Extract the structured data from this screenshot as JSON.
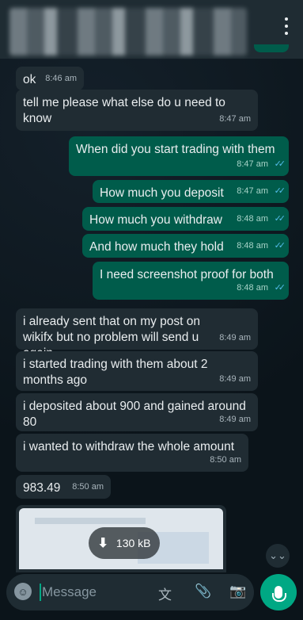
{
  "header": {
    "menu_icon": "more-vertical-icon"
  },
  "messages": [
    {
      "dir": "in",
      "text": "ok",
      "time": "8:46 am"
    },
    {
      "dir": "in",
      "text": "tell me please what else do u need to know",
      "time": "8:47 am"
    },
    {
      "dir": "out",
      "text": "When did you start trading with them",
      "time": "8:47 am"
    },
    {
      "dir": "out",
      "text": "How much you deposit",
      "time": "8:47 am"
    },
    {
      "dir": "out",
      "text": "How much you withdraw",
      "time": "8:48 am"
    },
    {
      "dir": "out",
      "text": "And how much they hold",
      "time": "8:48 am"
    },
    {
      "dir": "out",
      "text": "I need screenshot proof for both",
      "time": "8:48 am"
    },
    {
      "dir": "in",
      "text": "i already sent that on my post on wikifx but no problem will send u again",
      "time": "8:49 am"
    },
    {
      "dir": "in",
      "text": "i started trading with them about 2 months ago",
      "time": "8:49 am"
    },
    {
      "dir": "in",
      "text": "i deposited about 900 and gained around 80",
      "time": "8:49 am"
    },
    {
      "dir": "in",
      "text": "i wanted to withdraw the whole amount",
      "time": "8:50 am"
    },
    {
      "dir": "in",
      "text": "983.49",
      "time": "8:50 am"
    }
  ],
  "media": {
    "size": "130 kB"
  },
  "composer": {
    "placeholder": "Message",
    "icons": [
      "emoji-icon",
      "translate-icon",
      "attach-icon",
      "camera-icon",
      "mic-icon"
    ]
  },
  "colors": {
    "incoming": "#202c33",
    "outgoing": "#005c4b",
    "read_ticks": "#53bdeb",
    "accent": "#00a884"
  }
}
